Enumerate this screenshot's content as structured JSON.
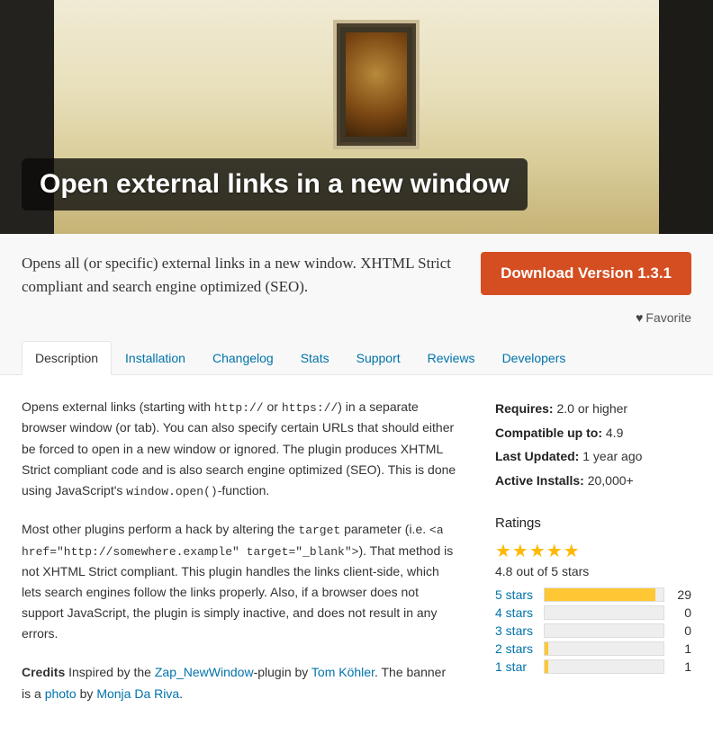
{
  "banner": {
    "title": "Open external links in a new window"
  },
  "header": {
    "summary": "Opens all (or specific) external links in a new window. XHTML Strict compliant and search engine optimized (SEO).",
    "download_label": "Download Version 1.3.1",
    "favorite_label": "Favorite"
  },
  "tabs": [
    {
      "label": "Description",
      "active": true
    },
    {
      "label": "Installation"
    },
    {
      "label": "Changelog"
    },
    {
      "label": "Stats"
    },
    {
      "label": "Support"
    },
    {
      "label": "Reviews"
    },
    {
      "label": "Developers"
    }
  ],
  "description": {
    "p1_a": "Opens external links (starting with ",
    "p1_code1": "http://",
    "p1_b": " or ",
    "p1_code2": "https://",
    "p1_c": ") in a separate browser window (or tab). You can also specify certain URLs that should either be forced to open in a new window or ignored. The plugin produces XHTML Strict compliant code and is also search engine optimized (SEO). This is done using JavaScript's ",
    "p1_code3": "window.open()",
    "p1_d": "-function.",
    "p2_a": "Most other plugins perform a hack by altering the ",
    "p2_code1": "target",
    "p2_b": " parameter (i.e. ",
    "p2_code2": "<a href=\"http://somewhere.example\" target=\"_blank\">",
    "p2_c": "). That method is not XHTML Strict compliant. This plugin handles the links client-side, which lets search engines follow the links properly. Also, if a browser does not support JavaScript, the plugin is simply inactive, and does not result in any errors.",
    "credits_label": "Credits",
    "credits_a": " Inspired by the ",
    "credits_link1": "Zap_NewWindow",
    "credits_b": "-plugin by ",
    "credits_link2": "Tom Köhler",
    "credits_c": ". The banner is a ",
    "credits_link3": "photo",
    "credits_d": " by ",
    "credits_link4": "Monja Da Riva",
    "credits_e": "."
  },
  "meta": {
    "requires_label": "Requires:",
    "requires_value": "2.0 or higher",
    "compat_label": "Compatible up to:",
    "compat_value": "4.9",
    "updated_label": "Last Updated:",
    "updated_value": "1 year ago",
    "installs_label": "Active Installs:",
    "installs_value": "20,000+"
  },
  "ratings": {
    "title": "Ratings",
    "summary": "4.8 out of 5 stars",
    "rows": [
      {
        "label": "5 stars",
        "pct": 93,
        "count": 29
      },
      {
        "label": "4 stars",
        "pct": 0,
        "count": 0
      },
      {
        "label": "3 stars",
        "pct": 0,
        "count": 0
      },
      {
        "label": "2 stars",
        "pct": 3,
        "count": 1
      },
      {
        "label": "1 star",
        "pct": 3,
        "count": 1
      }
    ]
  }
}
